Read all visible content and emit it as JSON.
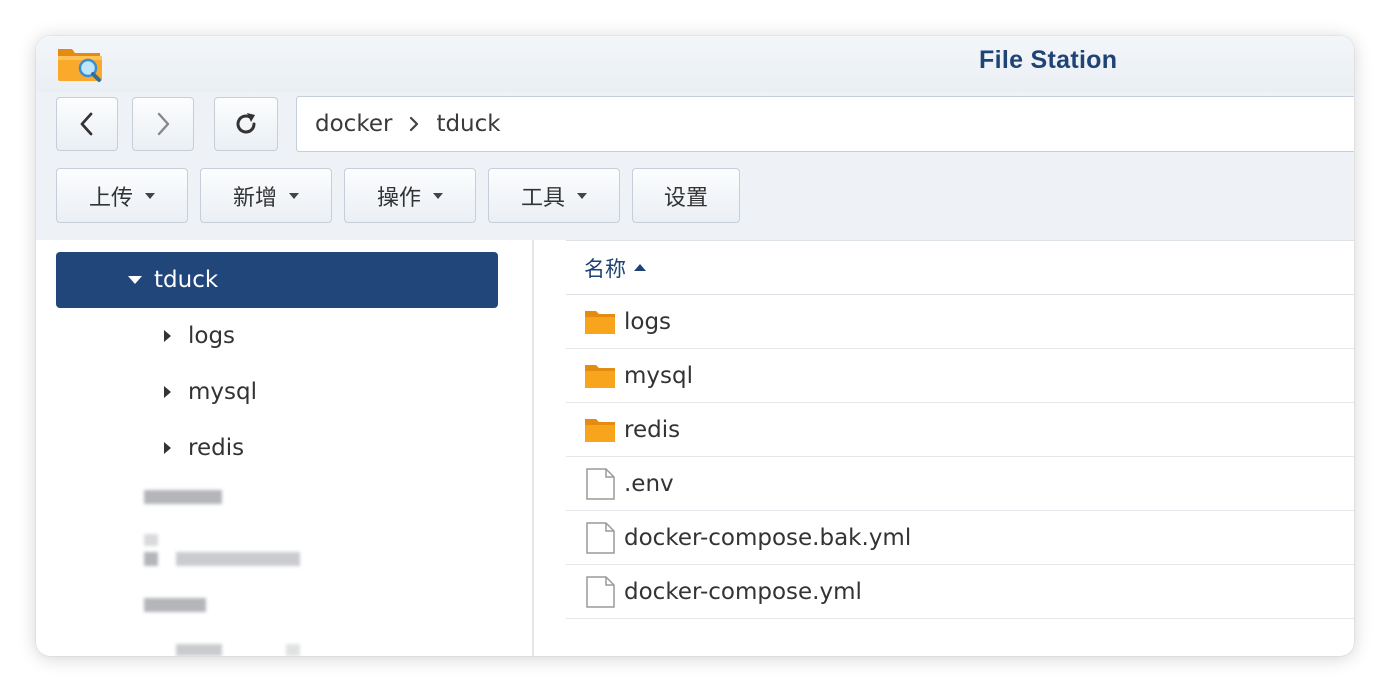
{
  "app": {
    "title": "File Station"
  },
  "nav": {
    "back_icon": "chevron-left-icon",
    "forward_icon": "chevron-right-icon",
    "refresh_icon": "refresh-icon"
  },
  "path": {
    "segments": [
      "docker",
      "tduck"
    ]
  },
  "actions": {
    "upload": "上传",
    "create": "新增",
    "action": "操作",
    "tools": "工具",
    "settings": "设置"
  },
  "tree": {
    "selected": "tduck",
    "children": [
      "logs",
      "mysql",
      "redis"
    ]
  },
  "list": {
    "header": {
      "name": "名称",
      "sort": "ascending"
    },
    "rows": [
      {
        "name": "logs",
        "type": "folder"
      },
      {
        "name": "mysql",
        "type": "folder"
      },
      {
        "name": "redis",
        "type": "folder"
      },
      {
        "name": ".env",
        "type": "file"
      },
      {
        "name": "docker-compose.bak.yml",
        "type": "file"
      },
      {
        "name": "docker-compose.yml",
        "type": "file"
      }
    ]
  },
  "colors": {
    "accent": "#21467a",
    "title": "#1e4374",
    "folder": "#f7a21b",
    "toolbar_bg": "#eef2f6"
  }
}
